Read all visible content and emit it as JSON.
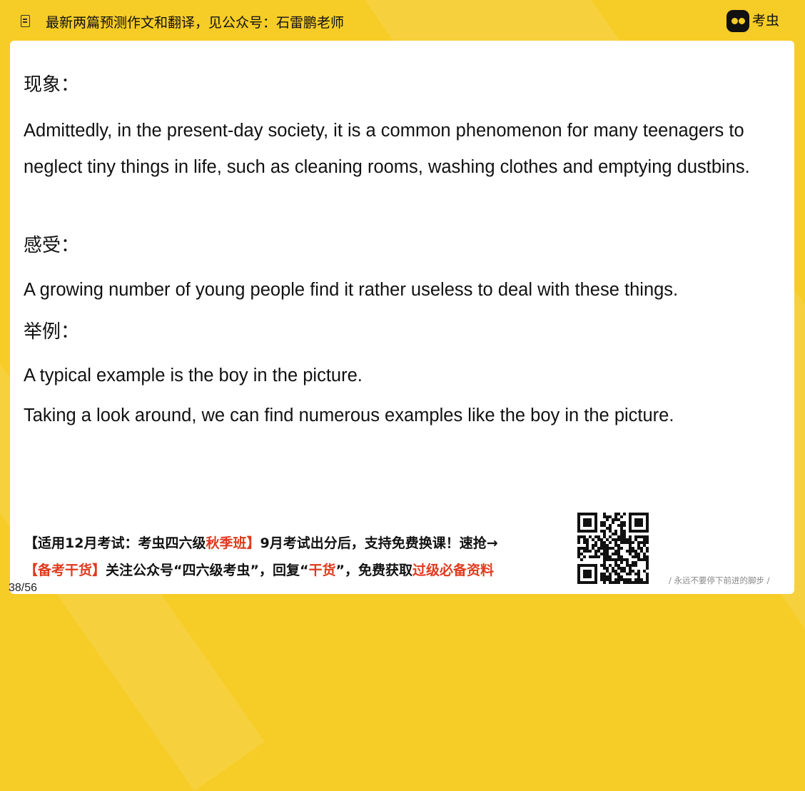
{
  "header": {
    "title": "最新两篇预测作文和翻译，见公众号：石雷鹏老师",
    "logo_text": "考虫",
    "doc_icon": "document-icon"
  },
  "content": {
    "heading_phenomenon": "现象：",
    "para_phenomenon": "Admittedly, in the present-day society, it is a common phenomenon for many teenagers to neglect tiny things in life, such as cleaning rooms, washing clothes and emptying dustbins.",
    "heading_feeling": "感受：",
    "para_feeling": "A growing number of young people find it rather useless to deal with these things.",
    "heading_example": "举例：",
    "example_line1": "A typical example is the boy in the picture.",
    "example_line2": "Taking a look around, we can find numerous examples like the boy in the picture."
  },
  "footer": {
    "promo1_a": "【适用12月考试：考虫四六级",
    "promo1_b": "秋季班】",
    "promo1_c": "9月考试出分后，支持免费换课！速抢→",
    "promo2_a": "【备考干货】",
    "promo2_b": "关注公众号“四六级考虫”，回复“",
    "promo2_c": "干货",
    "promo2_d": "”，免费获取",
    "promo2_e": "过级必备资料",
    "motto": "/ 永远不要停下前进的脚步 /",
    "page_number": "38/56",
    "accent_red": "#E03A1E"
  },
  "colors": {
    "background": "#F6CC27",
    "card": "#FFFFFF",
    "text": "#111111"
  }
}
